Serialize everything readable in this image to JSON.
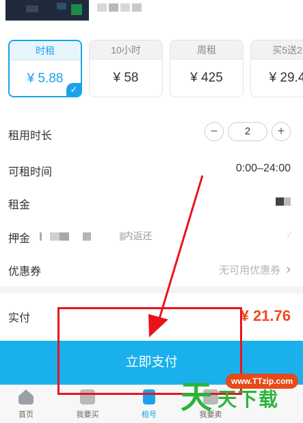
{
  "plans": [
    {
      "name": "时租",
      "price": "¥ 5.88",
      "active": true
    },
    {
      "name": "10小时",
      "price": "¥ 58",
      "active": false
    },
    {
      "name": "周租",
      "price": "¥ 425",
      "active": false
    },
    {
      "name": "买5送2",
      "price": "¥ 29.4",
      "active": false
    }
  ],
  "rows": {
    "duration": {
      "label": "租用时长",
      "minus": "−",
      "value": "2",
      "plus": "+"
    },
    "rent_time": {
      "label": "可租时间",
      "value": "0:00–24:00"
    },
    "rent": {
      "label": "租金"
    },
    "deposit": {
      "label": "押金",
      "value_visible": "内返还",
      "value_prefix": "།"
    },
    "coupon": {
      "label": "优惠券",
      "value": "无可用优惠券",
      "chevron": "›"
    },
    "actual": {
      "label": "实付",
      "value": "¥ 21.76"
    }
  },
  "pay_button": {
    "label": "立即支付"
  },
  "tabbar": {
    "items": [
      {
        "label": "首页",
        "icon": "home-icon"
      },
      {
        "label": "我要买",
        "icon": "cart-icon"
      },
      {
        "label": "租号",
        "icon": "phone-icon"
      },
      {
        "label": "我要卖",
        "icon": "sell-icon"
      }
    ]
  },
  "watermark": {
    "url": "www.TTzip.com",
    "glyph": "天",
    "text": "天下载"
  },
  "colors": {
    "accent": "#1aa3ea",
    "pay_button": "#1ab0ec",
    "price_red": "#f04a1a",
    "annotation_red": "#e8141d",
    "watermark_green": "#2bb43c"
  }
}
